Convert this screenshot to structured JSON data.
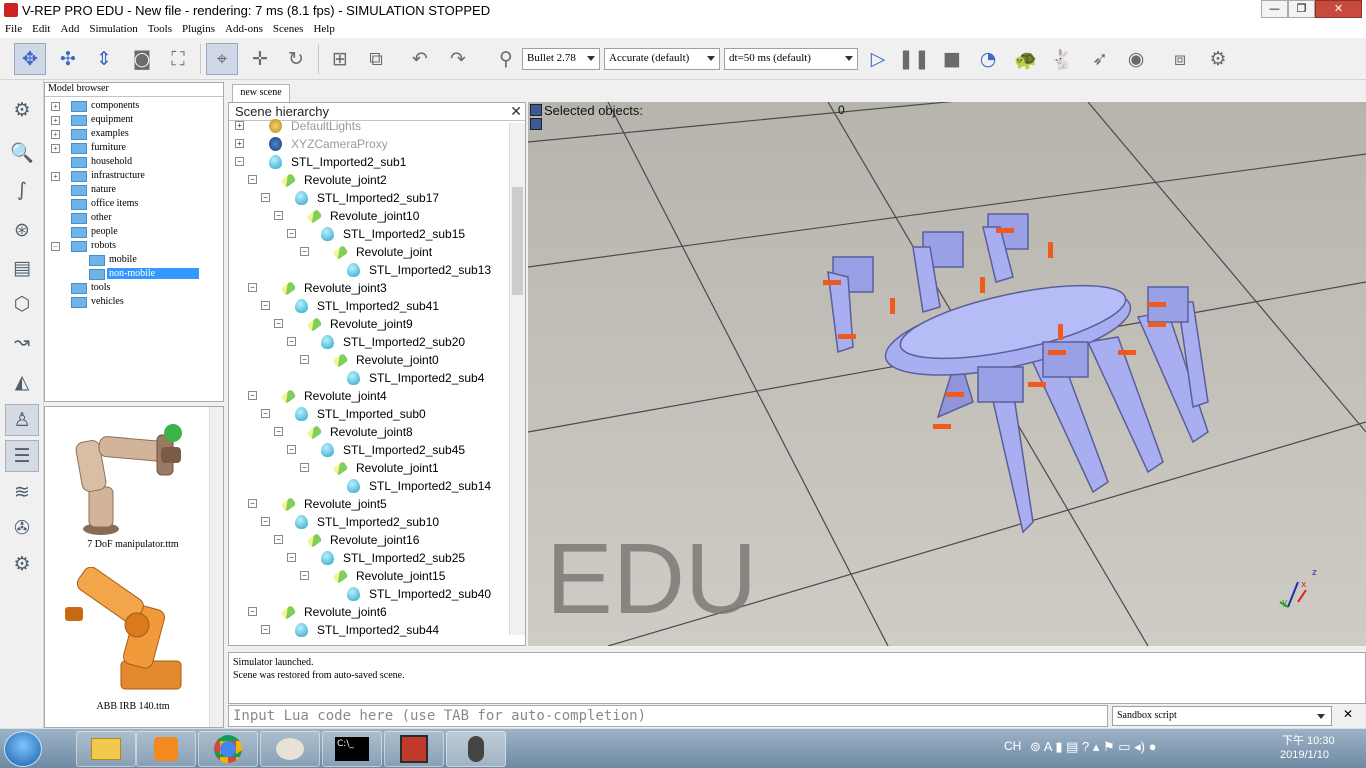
{
  "window": {
    "title": "V-REP PRO EDU - New file - rendering: 7 ms (8.1 fps) - SIMULATION STOPPED",
    "controls": [
      "—",
      "❐",
      "✕"
    ]
  },
  "menu": [
    "File",
    "Edit",
    "Add",
    "Simulation",
    "Tools",
    "Plugins",
    "Add-ons",
    "Scenes",
    "Help"
  ],
  "toolbar": {
    "engine": "Bullet 2.78",
    "accuracy": "Accurate (default)",
    "timestep": "dt=50 ms (default)",
    "icons": [
      "move-icon",
      "translate-icon",
      "rotate-icon",
      "camera-icon",
      "fit-view-icon",
      "select-icon",
      "object-shift-icon",
      "object-rotate-icon",
      "assemble-icon",
      "transfer-dna-icon",
      "undo-icon",
      "redo-icon",
      "dynamics-icon",
      "play-icon",
      "pause-icon",
      "stop-icon",
      "realtime-icon",
      "slow-icon",
      "fast-icon",
      "threaded-rendering-icon",
      "visualization-icon",
      "page-icon",
      "layers-icon"
    ]
  },
  "left_toolbar": [
    "settings-icon",
    "zoom-icon",
    "script-icon",
    "collections-icon",
    "document-icon",
    "shape-edit-icon",
    "path-edit-icon",
    "selection-icon",
    "model-browser-icon",
    "scene-hierarchy-icon",
    "layers-icon",
    "video-recorder-icon",
    "user-settings-icon"
  ],
  "model_browser": {
    "header": "Model browser",
    "items": [
      {
        "label": "components",
        "expand": "+"
      },
      {
        "label": "equipment",
        "expand": "+"
      },
      {
        "label": "examples",
        "expand": "+"
      },
      {
        "label": "furniture",
        "expand": "+"
      },
      {
        "label": "household",
        "expand": ""
      },
      {
        "label": "infrastructure",
        "expand": "+"
      },
      {
        "label": "nature",
        "expand": ""
      },
      {
        "label": "office items",
        "expand": ""
      },
      {
        "label": "other",
        "expand": ""
      },
      {
        "label": "people",
        "expand": ""
      },
      {
        "label": "robots",
        "expand": "−"
      },
      {
        "label": "mobile",
        "expand": ""
      },
      {
        "label": "non-mobile",
        "expand": ""
      },
      {
        "label": "tools",
        "expand": ""
      },
      {
        "label": "vehicles",
        "expand": ""
      }
    ],
    "thumbnails": [
      "7 DoF manipulator.ttm",
      "ABB IRB 140.ttm"
    ]
  },
  "scene_tab": "new scene",
  "hierarchy": {
    "header": "Scene hierarchy",
    "close": "✕",
    "rows": [
      {
        "label": "DefaultLights",
        "type": "light",
        "depth": 0,
        "expand": "+"
      },
      {
        "label": "XYZCameraProxy",
        "type": "cam",
        "depth": 0,
        "expand": "+"
      },
      {
        "label": "STL_Imported2_sub1",
        "type": "shape",
        "depth": 0,
        "expand": "−"
      },
      {
        "label": "Revolute_joint2",
        "type": "joint",
        "depth": 1,
        "expand": "−"
      },
      {
        "label": "STL_Imported2_sub17",
        "type": "shape",
        "depth": 2,
        "expand": "−"
      },
      {
        "label": "Revolute_joint10",
        "type": "joint",
        "depth": 3,
        "expand": "−"
      },
      {
        "label": "STL_Imported2_sub15",
        "type": "shape",
        "depth": 4,
        "expand": "−"
      },
      {
        "label": "Revolute_joint",
        "type": "joint",
        "depth": 5,
        "expand": "−"
      },
      {
        "label": "STL_Imported2_sub13",
        "type": "shape",
        "depth": 6,
        "expand": ""
      },
      {
        "label": "Revolute_joint3",
        "type": "joint",
        "depth": 1,
        "expand": "−"
      },
      {
        "label": "STL_Imported2_sub41",
        "type": "shape",
        "depth": 2,
        "expand": "−"
      },
      {
        "label": "Revolute_joint9",
        "type": "joint",
        "depth": 3,
        "expand": "−"
      },
      {
        "label": "STL_Imported2_sub20",
        "type": "shape",
        "depth": 4,
        "expand": "−"
      },
      {
        "label": "Revolute_joint0",
        "type": "joint",
        "depth": 5,
        "expand": "−"
      },
      {
        "label": "STL_Imported2_sub4",
        "type": "shape",
        "depth": 6,
        "expand": ""
      },
      {
        "label": "Revolute_joint4",
        "type": "joint",
        "depth": 1,
        "expand": "−"
      },
      {
        "label": "STL_Imported_sub0",
        "type": "shape",
        "depth": 2,
        "expand": "−"
      },
      {
        "label": "Revolute_joint8",
        "type": "joint",
        "depth": 3,
        "expand": "−"
      },
      {
        "label": "STL_Imported2_sub45",
        "type": "shape",
        "depth": 4,
        "expand": "−"
      },
      {
        "label": "Revolute_joint1",
        "type": "joint",
        "depth": 5,
        "expand": "−"
      },
      {
        "label": "STL_Imported2_sub14",
        "type": "shape",
        "depth": 6,
        "expand": ""
      },
      {
        "label": "Revolute_joint5",
        "type": "joint",
        "depth": 1,
        "expand": "−"
      },
      {
        "label": "STL_Imported2_sub10",
        "type": "shape",
        "depth": 2,
        "expand": "−"
      },
      {
        "label": "Revolute_joint16",
        "type": "joint",
        "depth": 3,
        "expand": "−"
      },
      {
        "label": "STL_Imported2_sub25",
        "type": "shape",
        "depth": 4,
        "expand": "−"
      },
      {
        "label": "Revolute_joint15",
        "type": "joint",
        "depth": 5,
        "expand": "−"
      },
      {
        "label": "STL_Imported2_sub40",
        "type": "shape",
        "depth": 6,
        "expand": ""
      },
      {
        "label": "Revolute_joint6",
        "type": "joint",
        "depth": 1,
        "expand": "−"
      },
      {
        "label": "STL_Imported2_sub44",
        "type": "shape",
        "depth": 2,
        "expand": "−"
      }
    ]
  },
  "viewport": {
    "selected_label": "Selected objects:",
    "selected_count": "0",
    "watermark": "EDU",
    "axes": [
      "x",
      "y",
      "z"
    ]
  },
  "console": {
    "lines": [
      "Simulator launched.",
      "Scene was restored from auto-saved scene."
    ]
  },
  "lua": {
    "placeholder": "Input Lua code here (use TAB for auto-completion)",
    "script_select": "Sandbox script",
    "close": "✕"
  },
  "taskbar": {
    "apps": [
      "file-explorer-icon",
      "media-player-icon",
      "chrome-icon",
      "paint-icon",
      "cmd-icon",
      "app-icon",
      "vrep-icon"
    ],
    "cmd_text": "C:\\_",
    "lang": "CH",
    "time": "下午 10:30",
    "date": "2019/1/10"
  },
  "colors": {
    "robot": "#a8aef0",
    "floor": "#c7c4be",
    "accent": "#3399ff"
  }
}
